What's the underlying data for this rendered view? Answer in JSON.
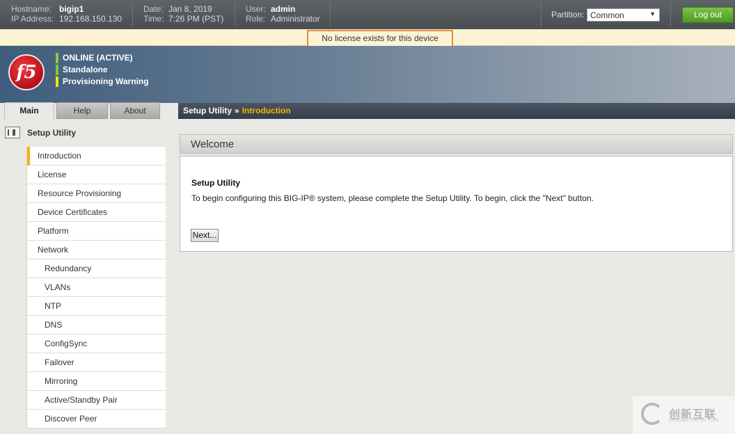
{
  "topbar": {
    "hostname_label": "Hostname:",
    "hostname": "bigip1",
    "ip_label": "IP Address:",
    "ip": "192.168.150.130",
    "date_label": "Date:",
    "date": "Jan 8, 2019",
    "time_label": "Time:",
    "time": "7:26 PM (PST)",
    "user_label": "User:",
    "user": "admin",
    "role_label": "Role:",
    "role": "Administrator",
    "partition_label": "Partition:",
    "partition_value": "Common",
    "logout_label": "Log out"
  },
  "license_message": "No license exists for this device",
  "header": {
    "logo_text": "f5",
    "status": [
      {
        "text": "ONLINE (ACTIVE)",
        "color": "#8dc63f"
      },
      {
        "text": "Standalone",
        "color": "#8dc63f"
      },
      {
        "text": "Provisioning Warning",
        "color": "#f5e400"
      }
    ]
  },
  "tabs": {
    "main": "Main",
    "help": "Help",
    "about": "About"
  },
  "breadcrumb": {
    "root": "Setup Utility",
    "separator": "»",
    "current": "Introduction"
  },
  "sidebar": {
    "title": "Setup Utility",
    "items": [
      {
        "label": "Introduction",
        "active": true,
        "sub": false
      },
      {
        "label": "License",
        "sub": false
      },
      {
        "label": "Resource Provisioning",
        "sub": false
      },
      {
        "label": "Device Certificates",
        "sub": false
      },
      {
        "label": "Platform",
        "sub": false
      },
      {
        "label": "Network",
        "sub": false
      },
      {
        "label": "Redundancy",
        "sub": true
      },
      {
        "label": "VLANs",
        "sub": true
      },
      {
        "label": "NTP",
        "sub": true
      },
      {
        "label": "DNS",
        "sub": true
      },
      {
        "label": "ConfigSync",
        "sub": true
      },
      {
        "label": "Failover",
        "sub": true
      },
      {
        "label": "Mirroring",
        "sub": true
      },
      {
        "label": "Active/Standby Pair",
        "sub": true
      },
      {
        "label": "Discover Peer",
        "sub": true
      }
    ]
  },
  "content": {
    "section_title": "Welcome",
    "heading": "Setup Utility",
    "text": "To begin configuring this BIG-IP® system, please complete the Setup Utility. To begin, click the \"Next\" button.",
    "next_label": "Next..."
  },
  "watermark": {
    "text": "创新互联",
    "sub": "CHUANG XIN HU LIAN"
  },
  "colors": {
    "accent": "#f5b400",
    "logout_green": "#5aa82a",
    "license_border": "#e58b3a"
  }
}
